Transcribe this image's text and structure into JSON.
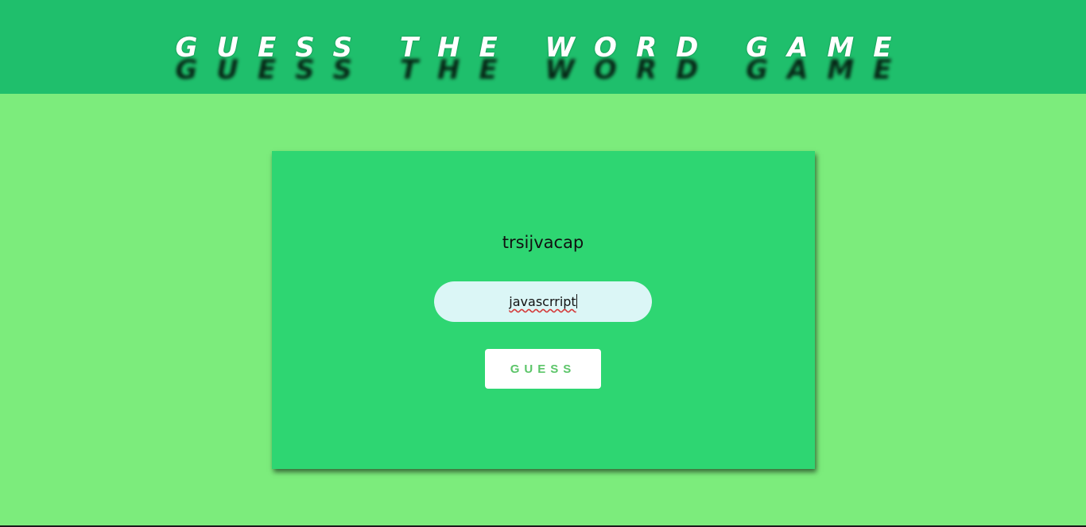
{
  "header": {
    "title": "GUESS THE WORD GAME"
  },
  "game": {
    "scrambled_word": "trsijvacap",
    "input_value": "javascrript",
    "guess_button_label": "GUESS"
  },
  "colors": {
    "page_background": "#7cec7c",
    "header_background": "#1fbf6c",
    "card_background": "#2ed672",
    "input_background": "#dbf6f6",
    "button_text": "#5cc569"
  }
}
